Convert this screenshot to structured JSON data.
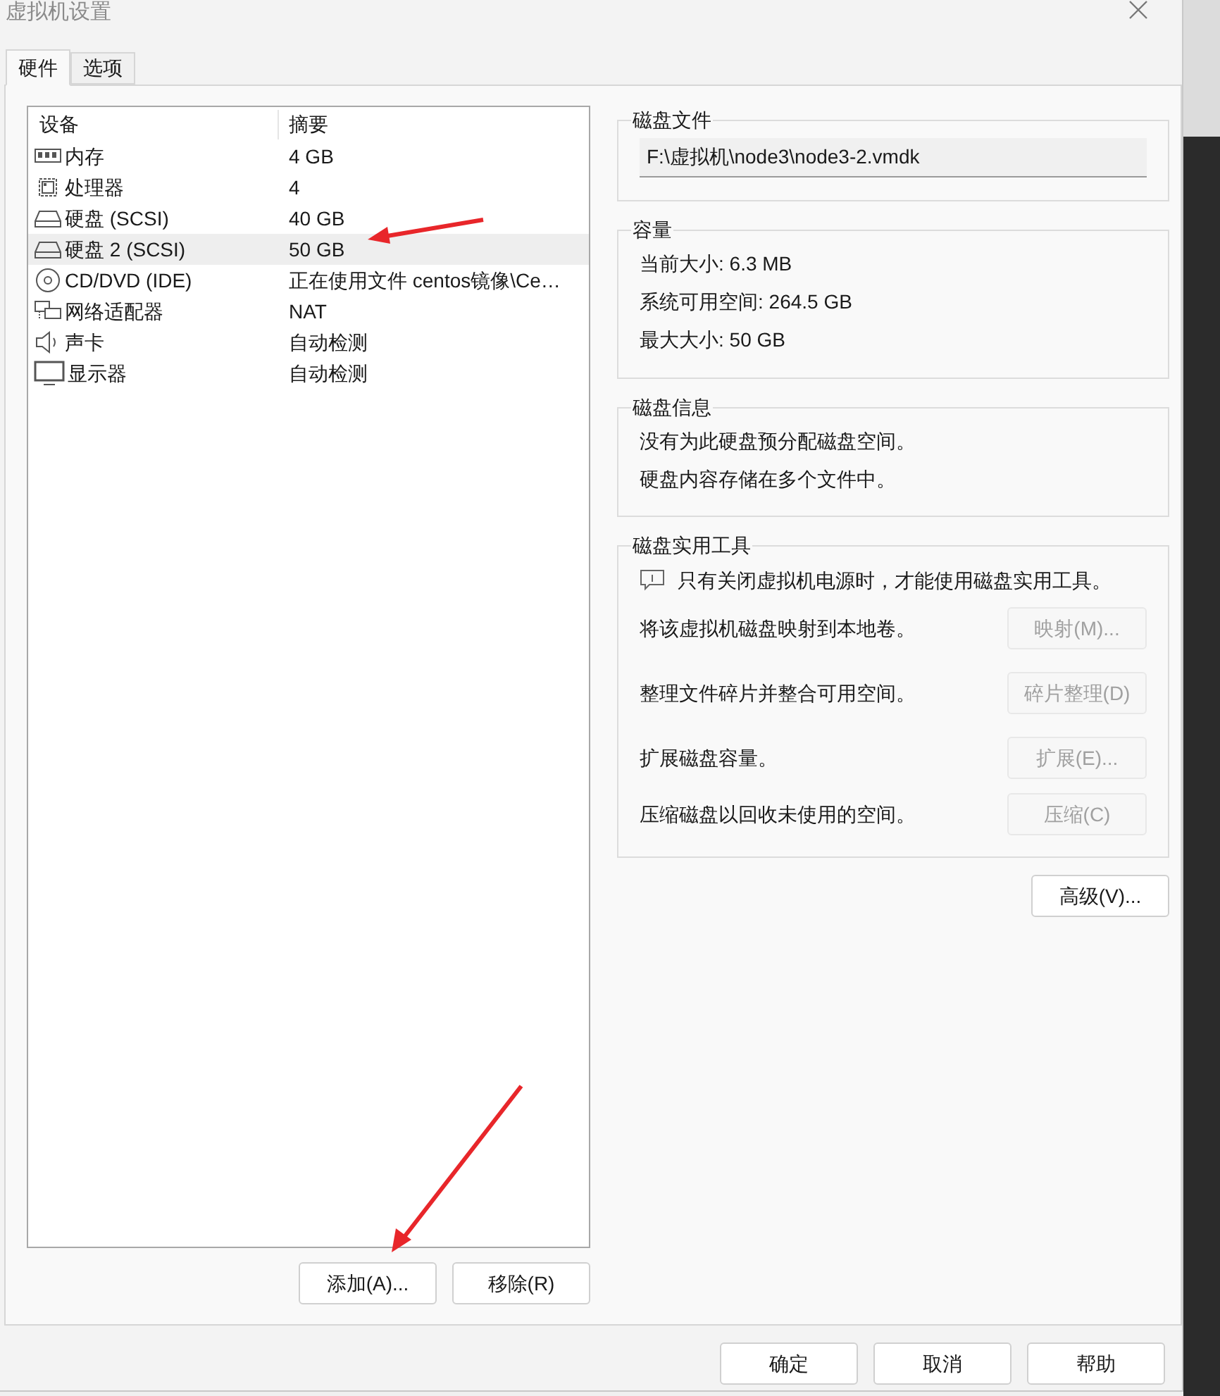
{
  "window": {
    "title": "虚拟机设置"
  },
  "tabs": [
    {
      "label": "硬件",
      "selected": true
    },
    {
      "label": "选项",
      "selected": false
    }
  ],
  "device_list": {
    "columns": [
      "设备",
      "摘要"
    ],
    "rows": [
      {
        "kind": "memory",
        "device": "内存",
        "summary": "4 GB",
        "selected": false
      },
      {
        "kind": "cpu",
        "device": "处理器",
        "summary": "4",
        "selected": false
      },
      {
        "kind": "disk",
        "device": "硬盘 (SCSI)",
        "summary": "40 GB",
        "selected": false
      },
      {
        "kind": "disk",
        "device": "硬盘 2 (SCSI)",
        "summary": "50 GB",
        "selected": true
      },
      {
        "kind": "cdrom",
        "device": "CD/DVD (IDE)",
        "summary": "正在使用文件 centos镜像\\Ce…",
        "selected": false
      },
      {
        "kind": "network",
        "device": "网络适配器",
        "summary": "NAT",
        "selected": false
      },
      {
        "kind": "sound",
        "device": "声卡",
        "summary": "自动检测",
        "selected": false
      },
      {
        "kind": "display",
        "device": "显示器",
        "summary": "自动检测",
        "selected": false
      }
    ]
  },
  "list_buttons": [
    "添加(A)...",
    "移除(R)"
  ],
  "disk_file": {
    "title": "磁盘文件",
    "path": "F:\\虚拟机\\node3\\node3-2.vmdk"
  },
  "capacity": {
    "title": "容量",
    "lines": [
      "当前大小: 6.3 MB",
      "系统可用空间: 264.5 GB",
      "最大大小: 50 GB"
    ]
  },
  "disk_info": {
    "title": "磁盘信息",
    "lines": [
      "没有为此硬盘预分配磁盘空间。",
      "硬盘内容存储在多个文件中。"
    ]
  },
  "utilities": {
    "title": "磁盘实用工具",
    "notice": "只有关闭虚拟机电源时，才能使用磁盘实用工具。",
    "rows": [
      {
        "label": "将该虚拟机磁盘映射到本地卷。",
        "button": "映射(M)...",
        "disabled": true
      },
      {
        "label": "整理文件碎片并整合可用空间。",
        "button": "碎片整理(D)",
        "disabled": true
      },
      {
        "label": "扩展磁盘容量。",
        "button": "扩展(E)...",
        "disabled": true
      },
      {
        "label": "压缩磁盘以回收未使用的空间。",
        "button": "压缩(C)",
        "disabled": true
      }
    ]
  },
  "advanced_button": "高级(V)...",
  "dialog_buttons": [
    "确定",
    "取消",
    "帮助"
  ]
}
